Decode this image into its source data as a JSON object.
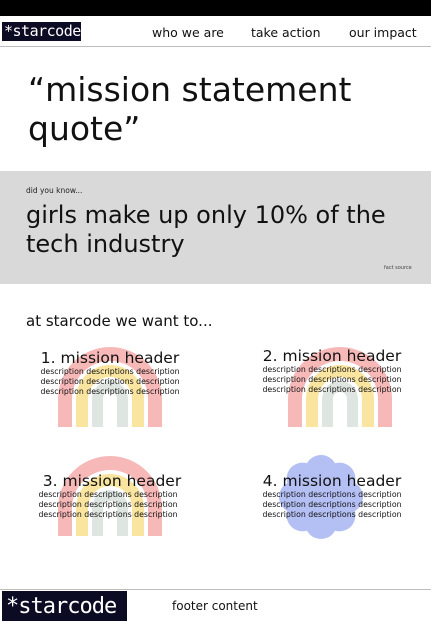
{
  "header": {
    "logo_text": "*starcode",
    "nav": [
      "who we are",
      "take action",
      "our impact"
    ]
  },
  "mission_quote": "“mission statement quote”",
  "fact": {
    "kicker": "did you know...",
    "text": "girls make up only 10% of the tech industry",
    "source": "fact source"
  },
  "want_heading": "at starcode we want to...",
  "missions": [
    {
      "header": "1. mission header",
      "lines": [
        "description descriptions description",
        "description descriptions description",
        "description descriptions description"
      ],
      "art": "rainbow-icon"
    },
    {
      "header": "2. mission header",
      "lines": [
        "description descriptions description",
        "description descriptions description",
        "description descriptions description"
      ],
      "art": "rainbow-icon"
    },
    {
      "header": "3. mission header",
      "lines": [
        "description descriptions description",
        "description descriptions description",
        "description descriptions description"
      ],
      "art": "rainbow-icon"
    },
    {
      "header": "4. mission header",
      "lines": [
        "description descriptions description",
        "description descriptions description",
        "description descriptions description"
      ],
      "art": "flower-icon"
    }
  ],
  "footer": {
    "logo_text": "*starcode",
    "content": "footer content"
  },
  "colors": {
    "dark_navy": "#0b0b23",
    "fact_band": "#d9d9d9",
    "rainbow_pink": "#f7b8b8",
    "rainbow_yellow": "#f9e5a0",
    "rainbow_gray": "#dfe6e2",
    "flower_blue": "#b4bff4"
  }
}
